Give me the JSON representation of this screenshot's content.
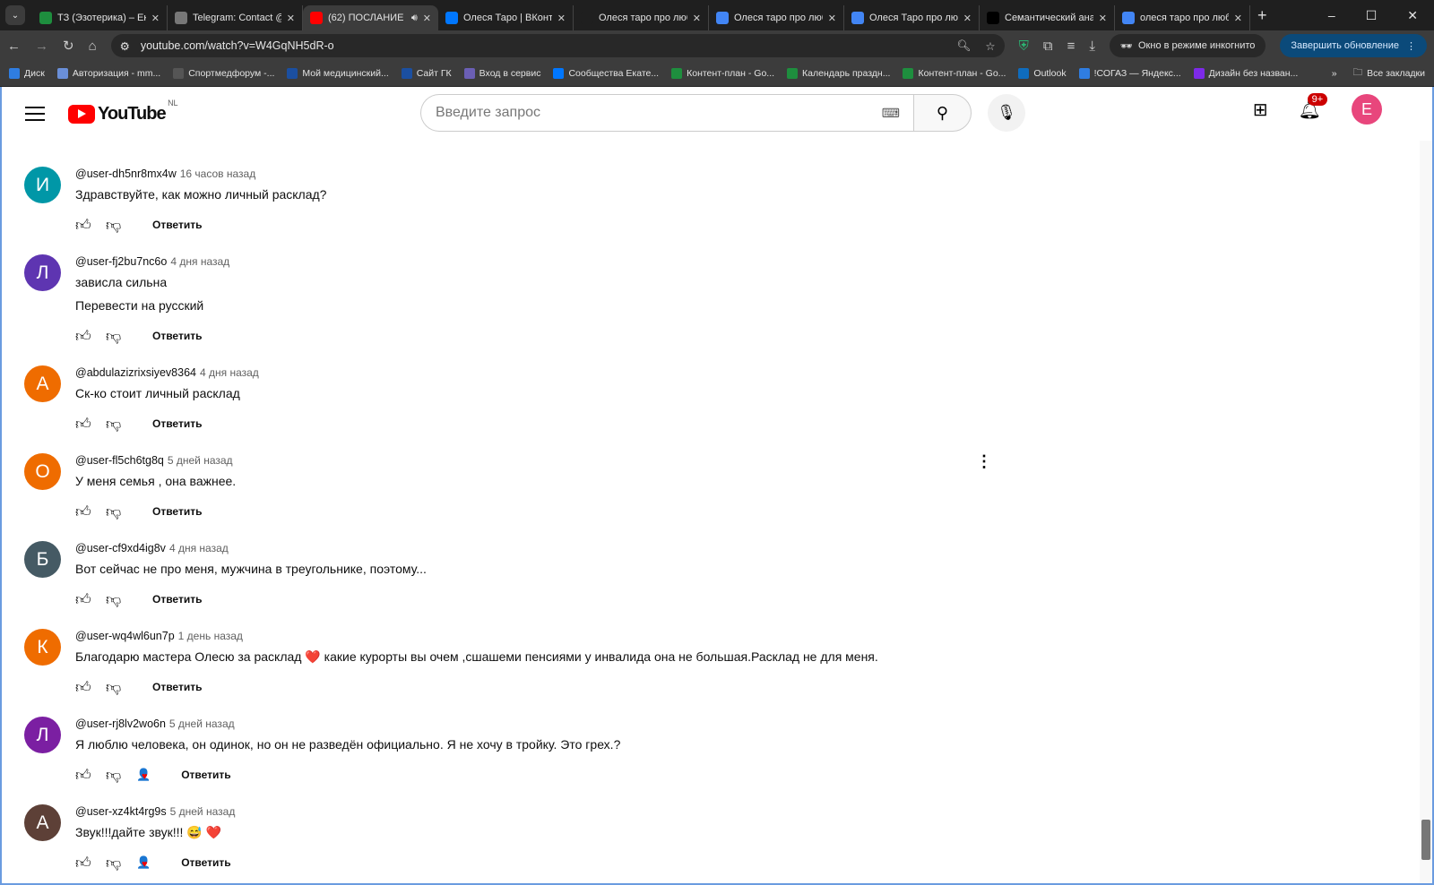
{
  "browser": {
    "tabs": [
      {
        "title": "ТЗ (Эзотерика) – Екат",
        "favicon": "sheets-icon",
        "color": "#1e8e3e"
      },
      {
        "title": "Telegram: Contact @g",
        "favicon": "globe-icon",
        "color": "#777777"
      },
      {
        "title": "(62) ПОСЛАНИЕ / ",
        "favicon": "youtube-icon",
        "color": "#ff0000",
        "active": true
      },
      {
        "title": "Олеся Таро | ВКонтак",
        "favicon": "vk-icon",
        "color": "#0077ff"
      },
      {
        "title": "Олеся таро про любо",
        "favicon": "sparkle-icon",
        "color": "#1f1f1f"
      },
      {
        "title": "Олеся таро про любо",
        "favicon": "google-icon",
        "color": "#4285f4"
      },
      {
        "title": "Олеся Таро про любо",
        "favicon": "docs-icon",
        "color": "#4285f4"
      },
      {
        "title": "Семантический анал",
        "favicon": "a-icon",
        "color": "#000000"
      },
      {
        "title": "олеся таро про любо",
        "favicon": "google-icon",
        "color": "#4285f4"
      }
    ],
    "url": "youtube.com/watch?v=W4GqNH5dR-o",
    "incognito_label": "Окно в режиме инкогнито",
    "update_label": "Завершить обновление",
    "bookmarks": [
      {
        "label": "Диск",
        "color": "#2f7de1"
      },
      {
        "label": "Авторизация - mm...",
        "color": "#6a8fd8"
      },
      {
        "label": "Спортмедфорум -...",
        "color": "#555"
      },
      {
        "label": "Мой медицинский...",
        "color": "#1b4fa0"
      },
      {
        "label": "Сайт ГК",
        "color": "#1b4fa0"
      },
      {
        "label": "Вход в сервис",
        "color": "#6b5fb5"
      },
      {
        "label": "Сообщества Екате...",
        "color": "#0077ff"
      },
      {
        "label": "Контент-план - Go...",
        "color": "#1e8e3e"
      },
      {
        "label": "Календарь праздн...",
        "color": "#1e8e3e"
      },
      {
        "label": "Контент-план - Go...",
        "color": "#1e8e3e"
      },
      {
        "label": "Outlook",
        "color": "#0f6cbd"
      },
      {
        "label": "!СОГАЗ — Яндекс...",
        "color": "#2f7de1"
      },
      {
        "label": "Дизайн без назван...",
        "color": "#7d2ae8"
      }
    ],
    "all_bookmarks": "Все закладки"
  },
  "youtube": {
    "logo_text": "YouTube",
    "region": "NL",
    "search_placeholder": "Введите запрос",
    "notifications_badge": "9+",
    "account_initial": "E",
    "reply_label": "Ответить",
    "comments": [
      {
        "initial": "И",
        "color": "#0097a7",
        "author": "@user-dh5nr8mx4w",
        "time": "16 часов назад",
        "lines": [
          "Здравствуйте, как можно личный расклад?"
        ]
      },
      {
        "initial": "Л",
        "color": "#5e35b1",
        "author": "@user-fj2bu7nc6o",
        "time": "4 дня назад",
        "lines": [
          "зависла сильна",
          "Перевести на русский"
        ]
      },
      {
        "initial": "A",
        "color": "#ef6c00",
        "author": "@abdulazizrixsiyev8364",
        "time": "4 дня назад",
        "lines": [
          "Ск-ко стоит личный расклад"
        ]
      },
      {
        "initial": "O",
        "color": "#ef6c00",
        "author": "@user-fl5ch6tg8q",
        "time": "5 дней назад",
        "lines": [
          "У меня семья , она важнее."
        ],
        "menu": true
      },
      {
        "initial": "Б",
        "color": "#455a64",
        "author": "@user-cf9xd4ig8v",
        "time": "4 дня назад",
        "lines": [
          "Вот сейчас не про меня, мужчина в треугольнике, поэтому..."
        ]
      },
      {
        "initial": "К",
        "color": "#ef6c00",
        "author": "@user-wq4wl6un7p",
        "time": "1 день назад",
        "lines": [
          "Благодарю мастера Олесю за расклад ❤️  какие курорты вы очем ,сшашеми пенсиями у инвалида она не большая.Расклад не для меня."
        ]
      },
      {
        "initial": "Л",
        "color": "#7b1fa2",
        "author": "@user-rj8lv2wo6n",
        "time": "5 дней назад",
        "lines": [
          "Я люблю человека, он одинок, но он не разведён официально. Я не хочу в тройку. Это грех.?"
        ],
        "hearted": true
      },
      {
        "initial": "A",
        "color": "#5d4037",
        "author": "@user-xz4kt4rg9s",
        "time": "5 дней назад",
        "lines": [
          "Звук!!!дайте звук!!! 😅 ❤️"
        ],
        "hearted": true
      }
    ]
  }
}
